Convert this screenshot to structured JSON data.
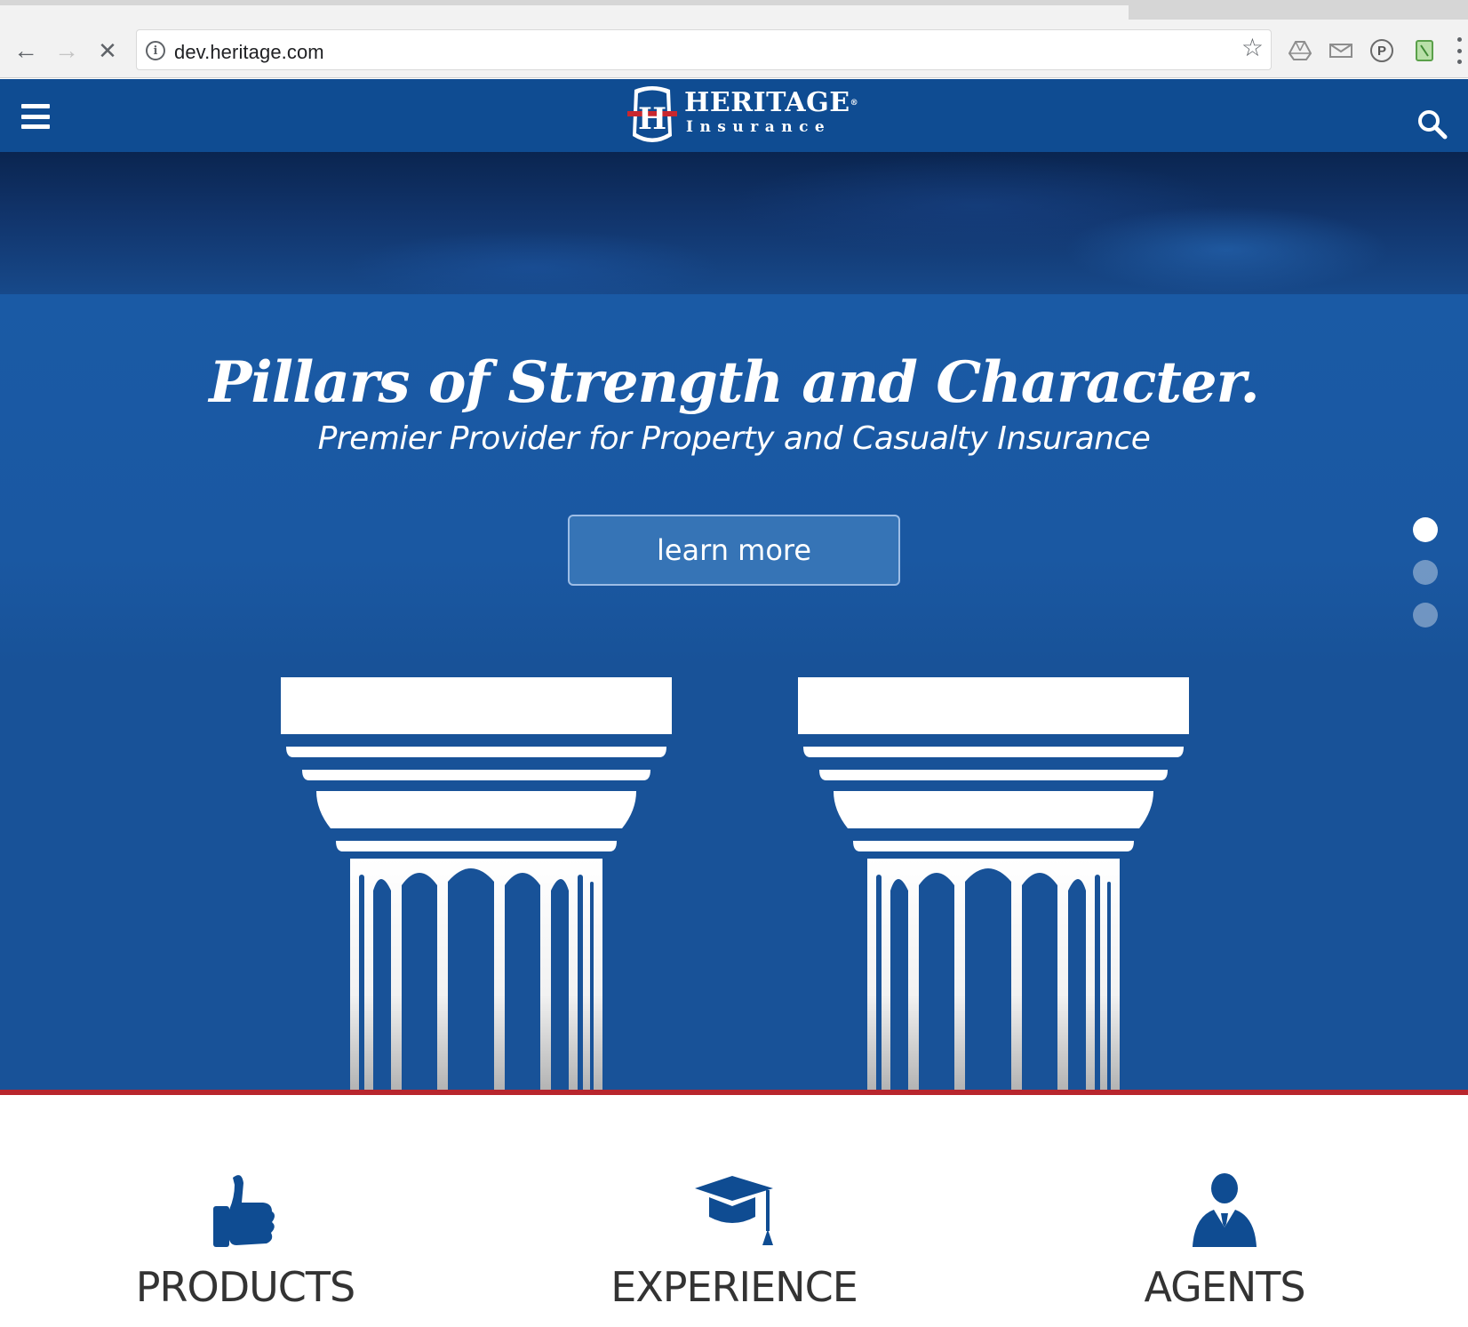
{
  "browser": {
    "url": "dev.heritage.com",
    "back_glyph": "←",
    "forward_glyph": "→",
    "stop_glyph": "✕",
    "info_glyph": "i",
    "star_glyph": "☆",
    "ext_p_glyph": "P"
  },
  "header": {
    "brand_name": "HERITAGE",
    "brand_mark": "®",
    "brand_sub": "Insurance",
    "logo_letter": "H",
    "colors": {
      "bar": "#0f4c92",
      "accent_red": "#b8262d"
    }
  },
  "hero": {
    "title": "Pillars of Strength and Character.",
    "subtitle": "Premier Provider for Property and Casualty Insurance",
    "cta_label": "learn more",
    "slides": {
      "count": 3,
      "active": 1
    }
  },
  "features": [
    {
      "label": "PRODUCTS",
      "icon": "thumbs-up-icon"
    },
    {
      "label": "EXPERIENCE",
      "icon": "graduation-cap-icon"
    },
    {
      "label": "AGENTS",
      "icon": "agent-person-icon"
    }
  ]
}
